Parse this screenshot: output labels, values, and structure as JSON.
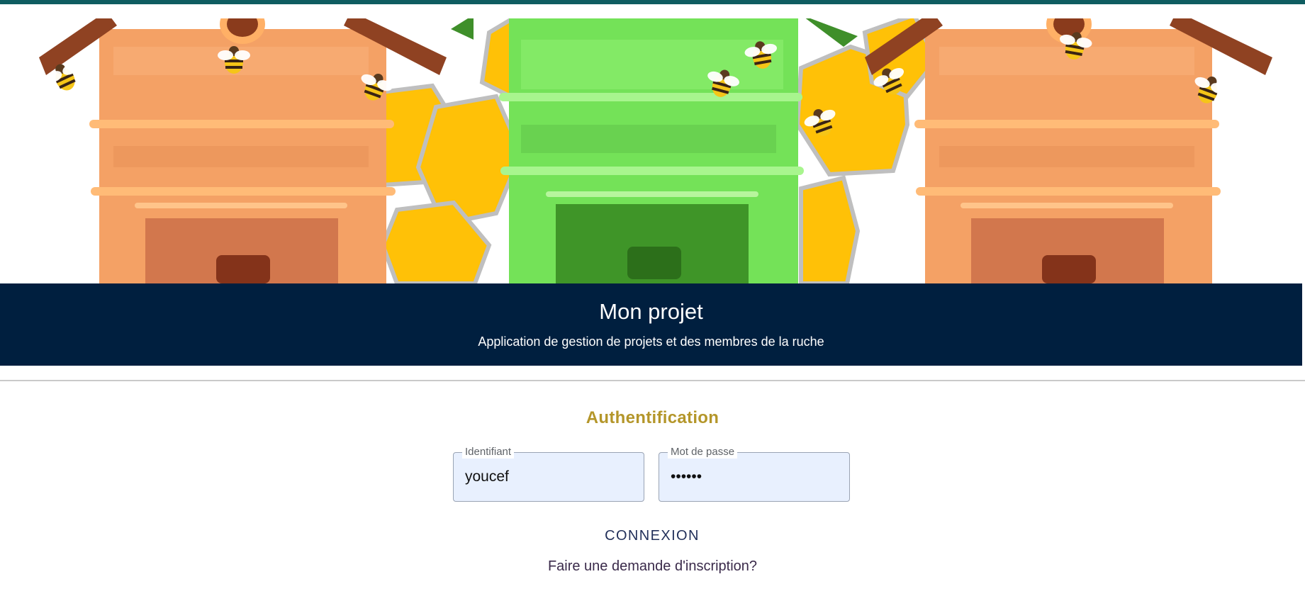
{
  "header": {
    "title": "Mon projet",
    "subtitle": "Application de gestion de projets et des membres de la ruche"
  },
  "banner": {
    "illustration": "beehives-illustration",
    "colors": {
      "orange_hive": "#f4a165",
      "green_hive": "#78e05a",
      "honeycomb": "#ffc107",
      "roof": "#8f4222"
    }
  },
  "auth": {
    "title": "Authentification",
    "username": {
      "label": "Identifiant",
      "value": "youcef"
    },
    "password": {
      "label": "Mot de passe",
      "value": "••••••"
    },
    "login_label": "CONNEXION",
    "signup_label": "Faire une demande d'inscription?"
  },
  "theme": {
    "accent_stripe": "#0f5d61",
    "title_band": "#001f3f",
    "auth_title_color": "#b4962a",
    "input_background": "#e8f0fe"
  }
}
